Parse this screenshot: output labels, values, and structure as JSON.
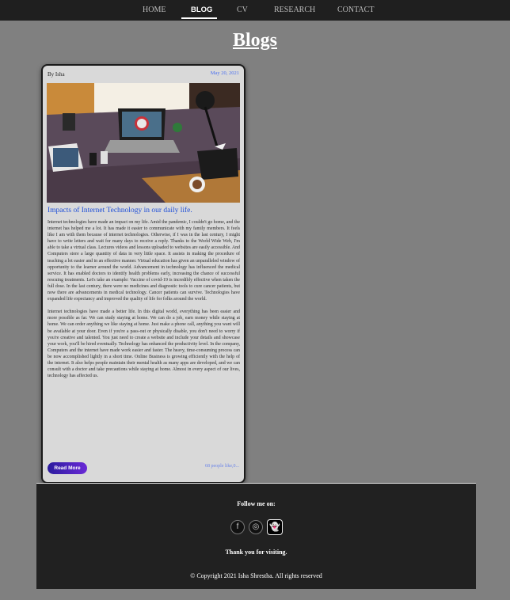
{
  "nav": {
    "items": [
      {
        "label": "HOME"
      },
      {
        "label": "BLOG"
      },
      {
        "label": "CV"
      },
      {
        "label": "RESEARCH"
      },
      {
        "label": "CONTACT"
      }
    ],
    "active": "BLOG"
  },
  "page": {
    "title": "Blogs"
  },
  "post": {
    "author": "By Isha",
    "date": "May 20, 2021",
    "image_alt": "desk-with-laptop-and-devices",
    "title": "Impacts of Internet Technology in our daily life.",
    "paragraphs": [
      "Internet technologies have made an impact on my life. Amid the pandemic, I couldn't go home, and the internet has helped me a lot. It has made it easier to communicate with my family members. It feels like I am with them because of internet technologies. Otherwise, if I was in the last century, I might have to write letters and wait for many days to receive a reply. Thanks to the World Wide Web, I'm able to take a virtual class. Lectures videos and lessons uploaded to websites are easily accessible. And Computers store a large quantity of data in very little space. It assists in making the procedure of teaching a lot easier and in an effective manner. Virtual education has given an unparalleled window of opportunity to the learner around the world. Advancement in technology has influenced the medical service. It has enabled doctors to identify health problems early, increasing the chance of successful rescuing treatments. Let's take an example: Vaccine of covid-19 is incredibly effective when taken the full dose. In the last century, there were no medicines and diagnostic tools to cure cancer patients, but now there are advancements in medical technology. Cancer patients can survive. Technologies have expanded life expectancy and improved the quality of life for folks around the world.",
      "Internet technologies have made a better life. In this digital world, everything has been easier and more possible as far. We can study staying at home. We can do a job, earn money while staying at home. We can order anything we like staying at home. Just make a phone call, anything you want will be available at your door. Even if you're a pass-out or physically disable, you don't need to worry if you're creative and talented. You just need to create a website and include your details and showcase your work, you'll be hired eventually. Technology has enhanced the productivity level. In the company, Computers and the internet have made work easier and faster. The heavy, time-consuming process can be now accomplished lightly in a short time. Online Business is growing efficiently with the help of the internet. It also helps people maintain their mental health as many apps are developed, and we can consult with a doctor and take precautions while staying at home. Almost in every aspect of our lives, technology has affected us."
    ],
    "read_more_label": "Read More",
    "likes": "68 people like,0..."
  },
  "footer": {
    "follow_label": "Follow me on:",
    "social": [
      {
        "icon": "facebook-icon",
        "glyph": "f"
      },
      {
        "icon": "instagram-icon",
        "glyph": "◎"
      },
      {
        "icon": "snapchat-icon",
        "glyph": "👻"
      }
    ],
    "thanks": "Thank you for visiting.",
    "copyright": "© Copyright 2021 Isha Shrestha. All rights reserved"
  },
  "colors": {
    "background": "#808080",
    "navbar": "#1f1f1f",
    "card": "#d9d9d9",
    "link_blue": "#1f4fd8",
    "button_gradient_start": "#2b1b9e",
    "button_gradient_end": "#6a2ad6",
    "footer": "#212121"
  }
}
